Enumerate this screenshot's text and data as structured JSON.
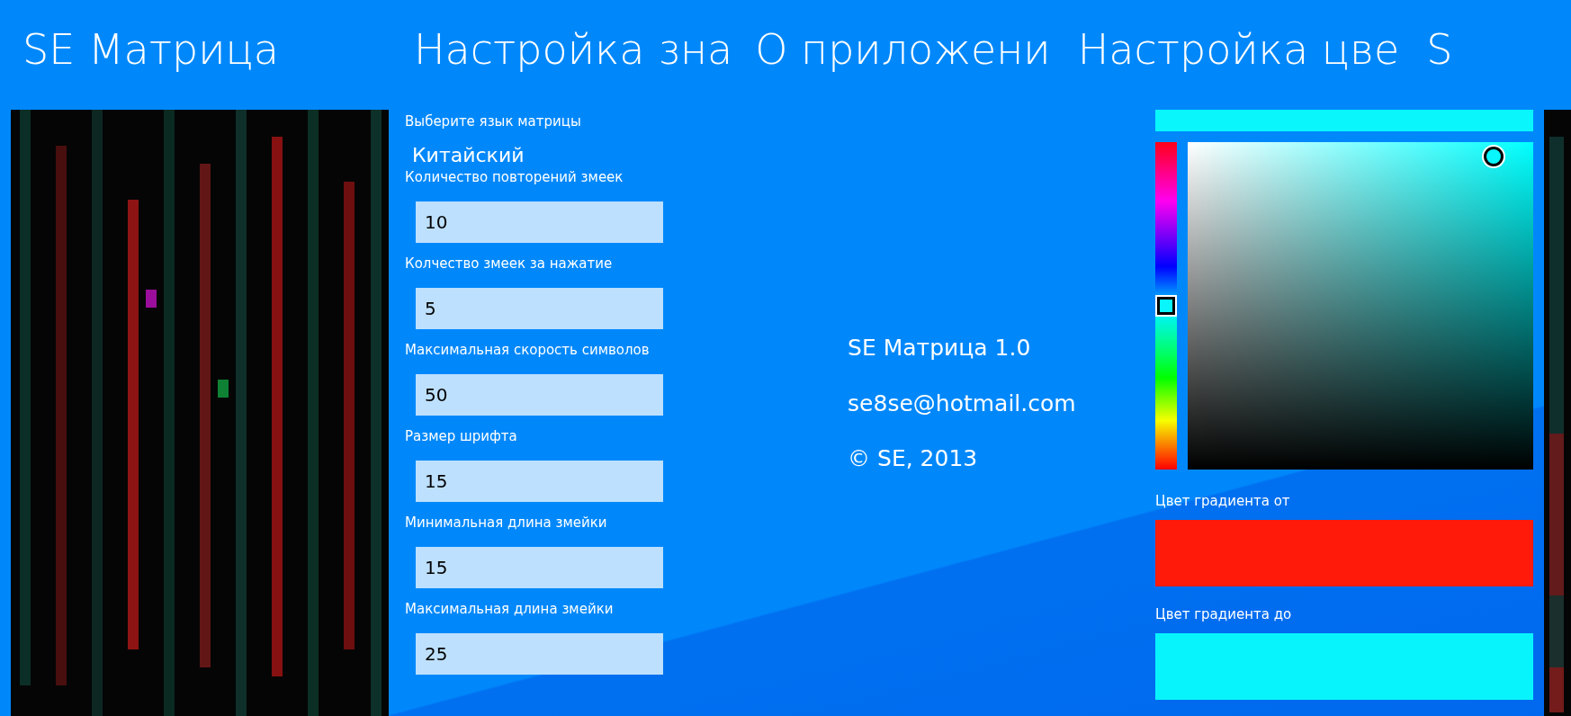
{
  "headers": [
    {
      "text": "SE Матрица"
    },
    {
      "text": "Настройка зна"
    },
    {
      "text": "О приложени"
    },
    {
      "text": "Настройка цве"
    },
    {
      "text": "S"
    }
  ],
  "settings": {
    "language_label": "Выберите язык матрицы",
    "language_value": "Китайский",
    "fields": [
      {
        "label": "Количество повторений змеек",
        "value": "10"
      },
      {
        "label": "Колчество  змеек за нажатие",
        "value": "5"
      },
      {
        "label": "Максимальная скорость символов",
        "value": "50"
      },
      {
        "label": "Размер шрифта",
        "value": "15"
      },
      {
        "label": "Минимальная длина змейки",
        "value": "15"
      },
      {
        "label": "Максимальная длина змейки",
        "value": "25"
      }
    ]
  },
  "about": {
    "lines": [
      "SE Матрица 1.0",
      "se8se@hotmail.com",
      "© SE, 2013"
    ]
  },
  "color_picker": {
    "color": "#08f6fc",
    "hue": {
      "level": 0.5
    },
    "gradient_from": {
      "label": "Цвет градиента от",
      "color": "#ff1a0a"
    },
    "gradient_to": {
      "label": "Цвет градиента до",
      "color": "#08f4fd"
    }
  }
}
